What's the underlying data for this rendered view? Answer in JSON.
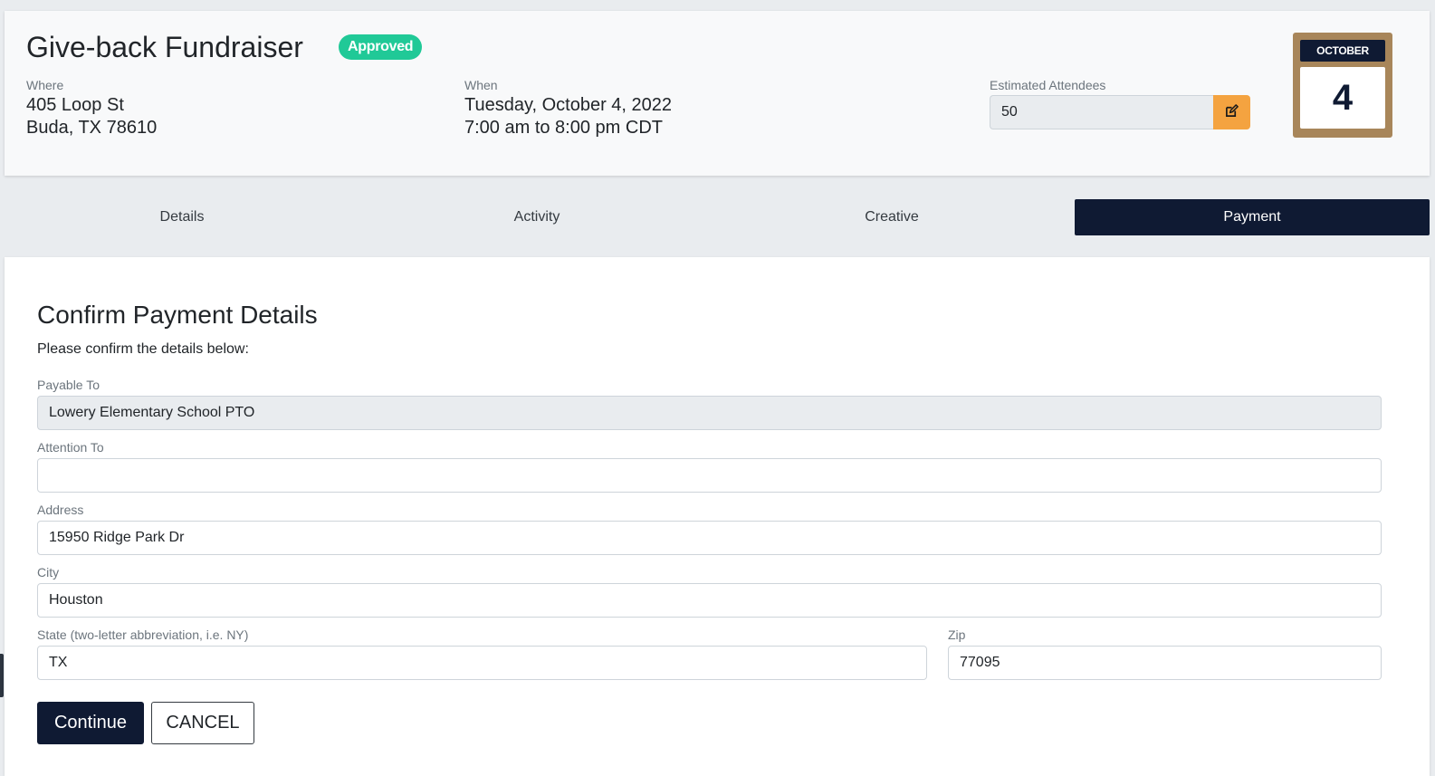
{
  "event": {
    "title": "Give-back Fundraiser",
    "status": "Approved",
    "where_label": "Where",
    "where_line1": "405 Loop St",
    "where_line2": "Buda, TX 78610",
    "when_label": "When",
    "when_date": "Tuesday, October 4, 2022",
    "when_time": "7:00 am to 8:00 pm CDT",
    "attendees_label": "Estimated Attendees",
    "attendees_value": "50",
    "edit_icon": "edit-icon"
  },
  "calendar": {
    "month": "OCTOBER",
    "day": "4"
  },
  "tabs": [
    {
      "label": "Details",
      "active": false
    },
    {
      "label": "Activity",
      "active": false
    },
    {
      "label": "Creative",
      "active": false
    },
    {
      "label": "Payment",
      "active": true
    }
  ],
  "form": {
    "title": "Confirm Payment Details",
    "subtitle": "Please confirm the details below:",
    "payable_to_label": "Payable To",
    "payable_to_value": "Lowery Elementary School PTO",
    "attention_to_label": "Attention To",
    "attention_to_value": "",
    "address_label": "Address",
    "address_value": "15950 Ridge Park Dr",
    "city_label": "City",
    "city_value": "Houston",
    "state_label": "State (two-letter abbreviation, i.e. NY)",
    "state_value": "TX",
    "zip_label": "Zip",
    "zip_value": "77095",
    "continue_label": "Continue",
    "cancel_label": "CANCEL"
  },
  "colors": {
    "navy": "#0f1a33",
    "approved_green": "#20c997",
    "edit_orange": "#f4a340",
    "calendar_frame": "#a8865a"
  }
}
